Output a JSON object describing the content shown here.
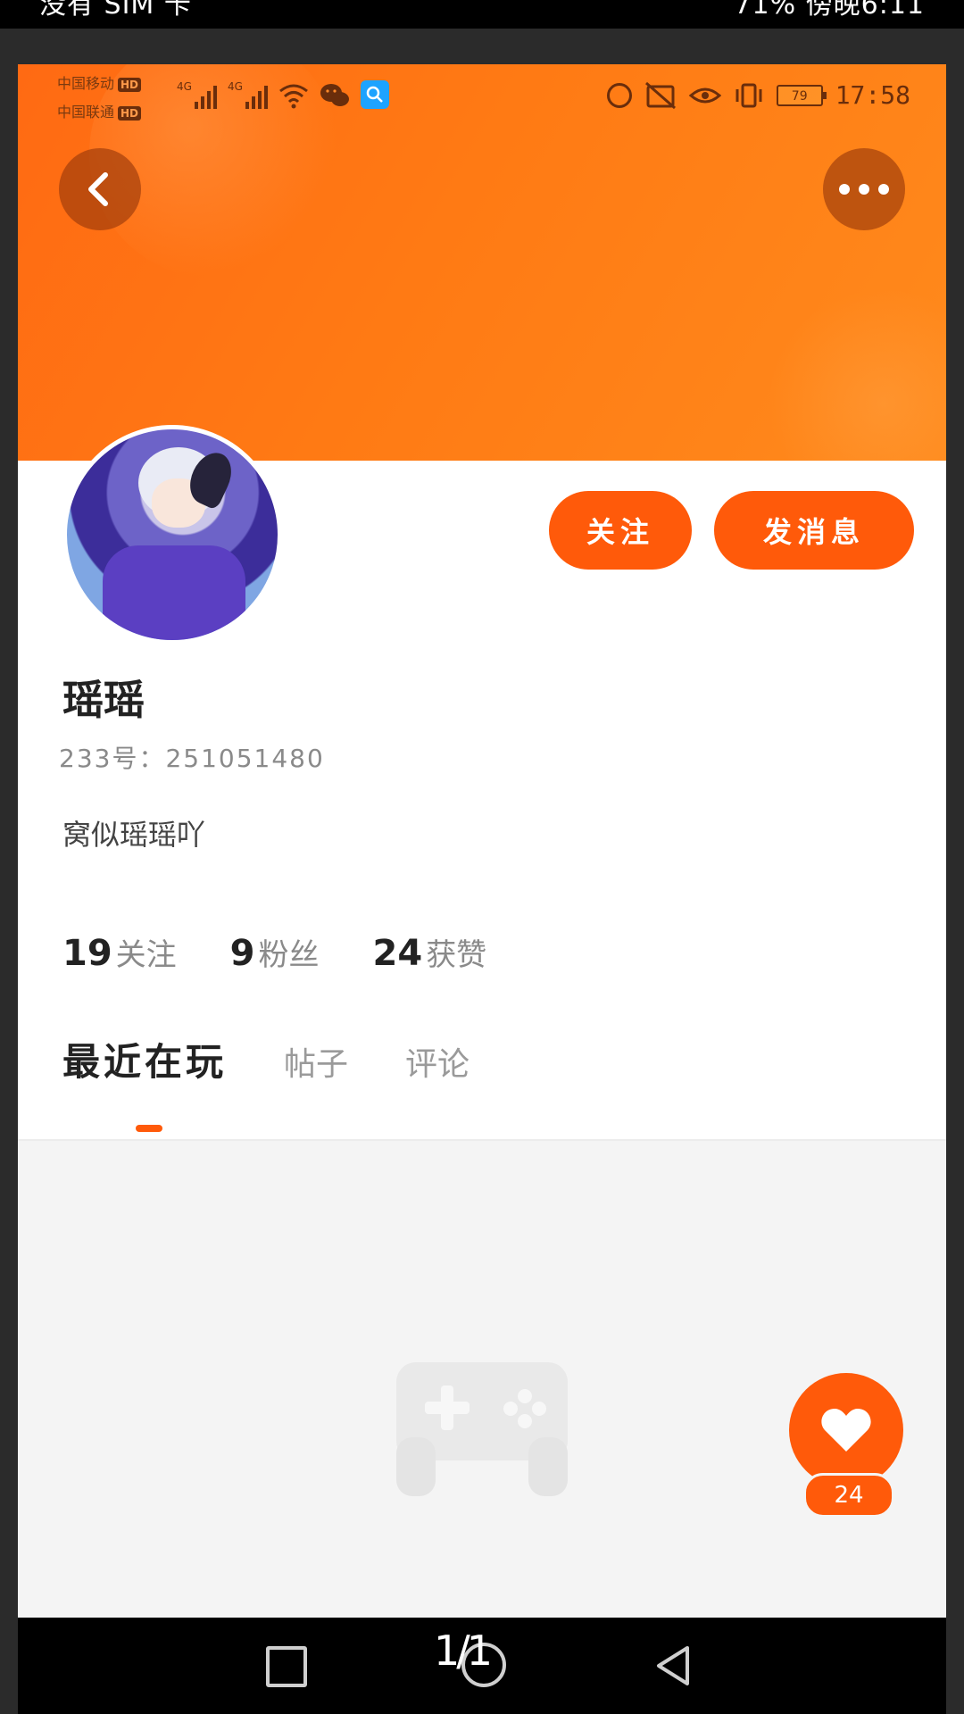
{
  "outer_status": {
    "left_text": "没有 SIM 卡",
    "right_text": "71%  傍晚6:11"
  },
  "inner_status": {
    "carrier1": "中国移动",
    "carrier2": "中国联通",
    "hd": "HD",
    "network": "4G",
    "battery": "79",
    "time": "17:58"
  },
  "profile": {
    "follow_label": "关注",
    "message_label": "发消息",
    "username": "瑶瑶",
    "uid": "233号：251051480",
    "bio": "窝似瑶瑶吖",
    "stats": [
      {
        "num": "19",
        "label": "关注"
      },
      {
        "num": "9",
        "label": "粉丝"
      },
      {
        "num": "24",
        "label": "获赞"
      }
    ]
  },
  "tabs": [
    {
      "label": "最近在玩",
      "active": true
    },
    {
      "label": "帖子",
      "active": false
    },
    {
      "label": "评论",
      "active": false
    }
  ],
  "like": {
    "count": "24"
  },
  "viewer": {
    "page_counter": "1/1"
  },
  "colors": {
    "accent": "#ff5a0a",
    "header": "#ff7a14"
  }
}
